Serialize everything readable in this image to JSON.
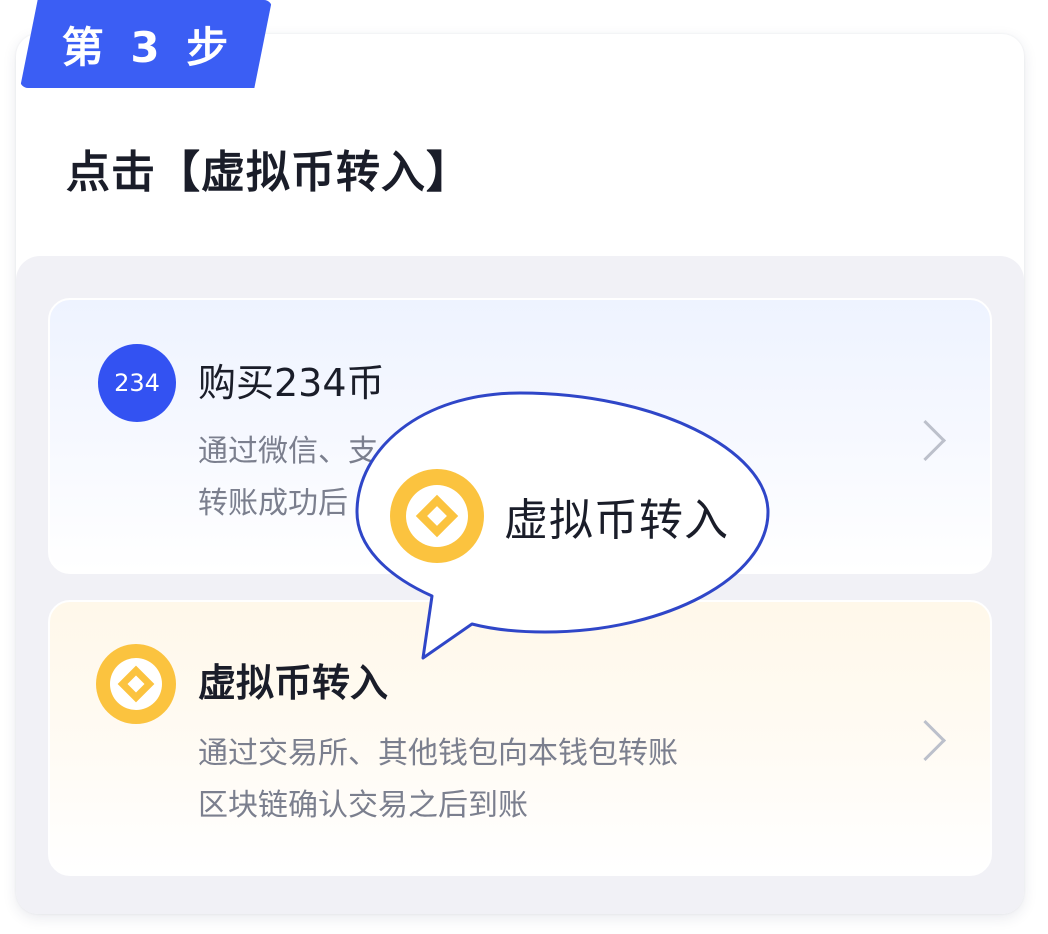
{
  "step": {
    "label": "第 3 步"
  },
  "title": "点击【虚拟币转入】",
  "options": [
    {
      "icon_text": "234",
      "icon": "coin-234-icon",
      "title": "购买234币",
      "desc_line1": "通过微信、支",
      "desc_line2": "转账成功后"
    },
    {
      "icon": "coin-diamond-icon",
      "title": "虚拟币转入",
      "desc_line1": "通过交易所、其他钱包向本钱包转账",
      "desc_line2": "区块链确认交易之后到账"
    }
  ],
  "callout": {
    "icon": "coin-diamond-icon",
    "label": "虚拟币转入"
  },
  "colors": {
    "accent": "#3b5ef4",
    "coin": "#fbc33f",
    "callout_border": "#2f46c8",
    "title": "#1a1d29",
    "desc": "#7b7f8e"
  }
}
